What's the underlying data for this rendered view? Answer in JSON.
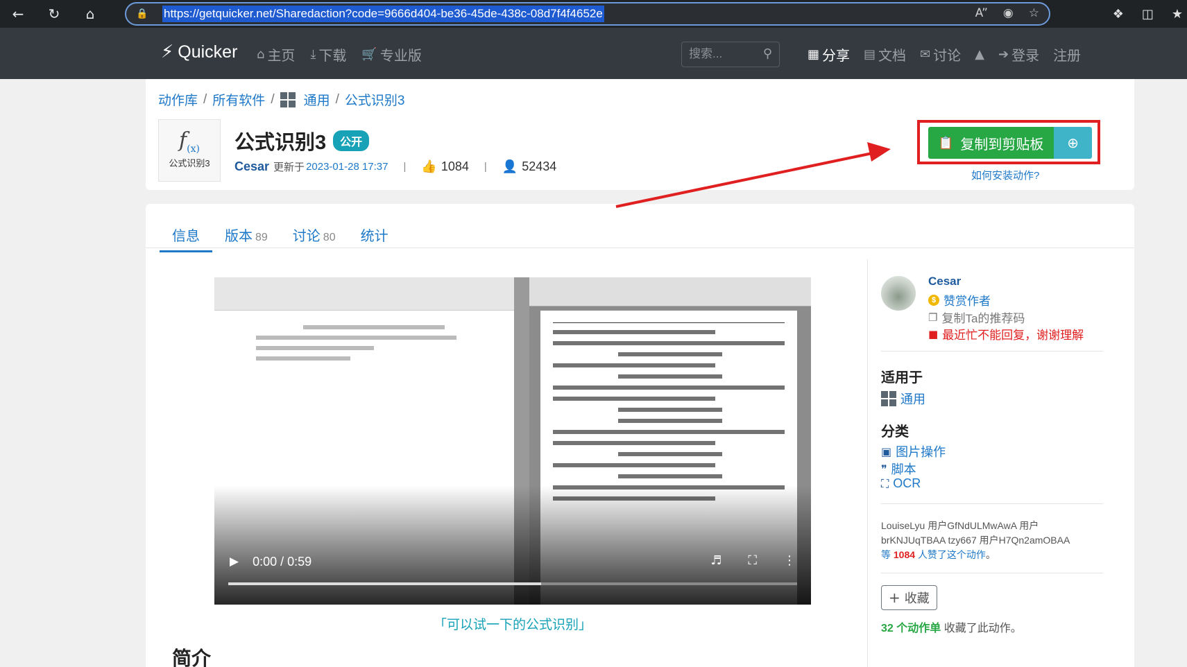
{
  "browser": {
    "url": "https://getquicker.net/Sharedaction?code=9666d404-be36-45de-438c-08d7f4f4652e"
  },
  "site": {
    "brand": "Quicker",
    "nav_left": [
      {
        "label": "主页",
        "icon": "home-icon"
      },
      {
        "label": "下载",
        "icon": "download-icon"
      },
      {
        "label": "专业版",
        "icon": "cart-icon"
      }
    ],
    "search_placeholder": "搜索...",
    "nav_right": [
      {
        "label": "分享",
        "icon": "share-grid-icon"
      },
      {
        "label": "文档",
        "icon": "docs-icon"
      },
      {
        "label": "讨论",
        "icon": "comments-icon"
      },
      {
        "label": "",
        "icon": "shirt-icon"
      },
      {
        "label": "登录",
        "icon": "login-icon"
      },
      {
        "label": "注册",
        "icon": ""
      }
    ]
  },
  "breadcrumb": [
    "动作库",
    "所有软件",
    "通用",
    "公式识别3"
  ],
  "action": {
    "icon_caption": "公式识别3",
    "title": "公式识别3",
    "badge": "公开",
    "author": "Cesar",
    "updated_label": "更新于",
    "updated_at": "2023-01-28 17:37",
    "likes": "1084",
    "users": "52434",
    "copy_button": "复制到剪贴板",
    "how_to_install": "如何安装动作?"
  },
  "tabs": [
    {
      "label": "信息",
      "count": ""
    },
    {
      "label": "版本",
      "count": "89"
    },
    {
      "label": "讨论",
      "count": "80"
    },
    {
      "label": "统计",
      "count": ""
    }
  ],
  "video": {
    "time": "0:00 / 0:59",
    "progress_fraction": 0.55,
    "caption": "「可以试一下的公式识别」"
  },
  "intro_heading": "简介",
  "author_panel": {
    "name": "Cesar",
    "sponsor": "赞赏作者",
    "copy_referral": "复制Ta的推荐码",
    "notice": "最近忙不能回复，谢谢理解"
  },
  "applies_to": {
    "heading": "适用于",
    "items": [
      "通用"
    ]
  },
  "category": {
    "heading": "分类",
    "items": [
      {
        "label": "图片操作",
        "icon": "image-icon"
      },
      {
        "label": "脚本",
        "icon": "script-icon"
      },
      {
        "label": "OCR",
        "icon": "scan-icon"
      }
    ]
  },
  "likers": {
    "line1": "LouiseLyu 用户GfNdULMwAwA 用户",
    "line2": "brKNJUqTBAA tzy667 用户H7Qn2amOBAA",
    "prefix": "等",
    "count": "1084",
    "suffix": "人赞了这个动作",
    "end": "。"
  },
  "favorite": {
    "button": "收藏",
    "count_text": "32 个动作单",
    "suffix": "收藏了此动作。"
  },
  "colors": {
    "accent": "#1e78c8",
    "copy_green": "#28a745",
    "teal": "#17a2b8",
    "annotation_red": "#e02020"
  }
}
